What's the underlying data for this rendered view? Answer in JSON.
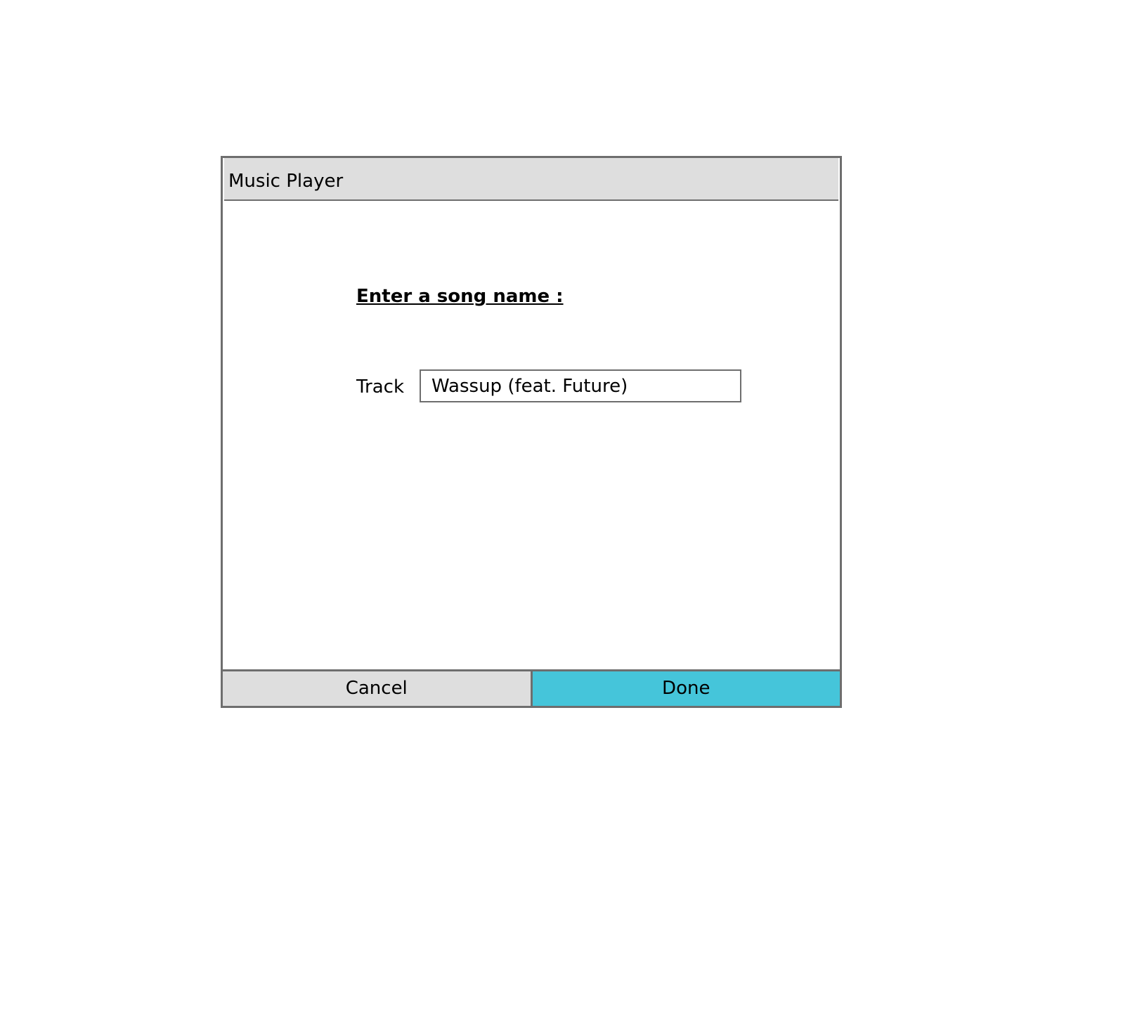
{
  "window": {
    "title": "Music Player"
  },
  "form": {
    "prompt": "Enter a song name :",
    "track_label": "Track",
    "track_value": "Wassup (feat. Future)"
  },
  "actions": {
    "cancel_label": "Cancel",
    "done_label": "Done"
  },
  "colors": {
    "titlebar": "#dedede",
    "border": "#6e6e6e",
    "cancel_bg": "#dedede",
    "done_bg": "#45c5da"
  }
}
